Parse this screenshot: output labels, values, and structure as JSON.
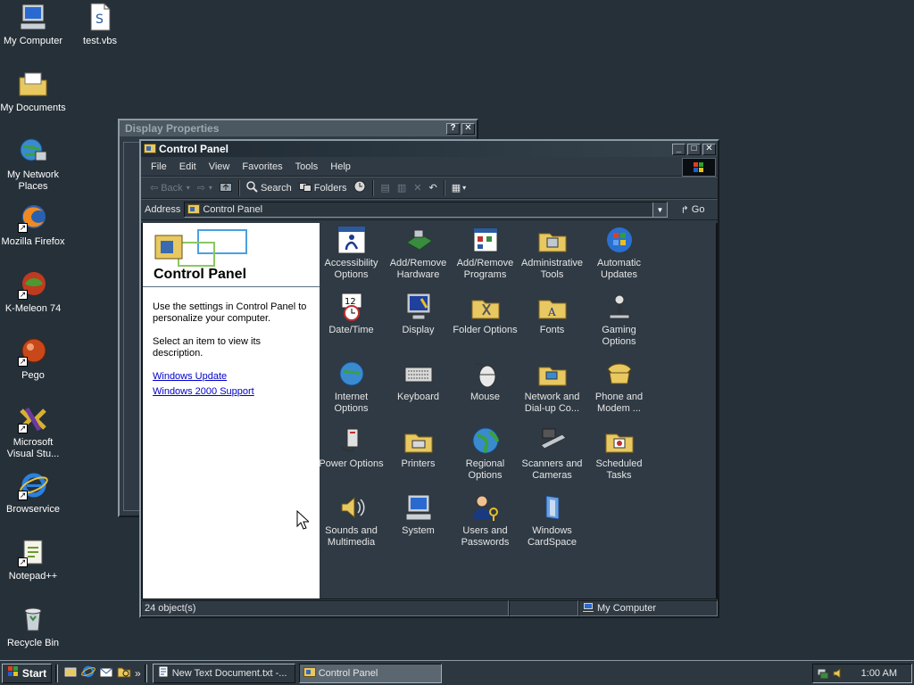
{
  "desktop": {
    "icons": [
      {
        "label": "My Computer"
      },
      {
        "label": "test.vbs"
      },
      {
        "label": "My Documents"
      },
      {
        "label": "My Network Places"
      },
      {
        "label": "Mozilla Firefox"
      },
      {
        "label": "K-Meleon 74"
      },
      {
        "label": "Pego"
      },
      {
        "label": "Microsoft Visual Stu..."
      },
      {
        "label": "Browservice"
      },
      {
        "label": "Notepad++"
      },
      {
        "label": "Recycle Bin"
      }
    ]
  },
  "display_properties": {
    "title": "Display Properties",
    "help_label": "?",
    "close_label": "✕"
  },
  "control_panel": {
    "title": "Control Panel",
    "min_label": "_",
    "max_label": "□",
    "close_label": "✕",
    "menu": [
      "File",
      "Edit",
      "View",
      "Favorites",
      "Tools",
      "Help"
    ],
    "toolbar": {
      "back": "Back",
      "search": "Search",
      "folders": "Folders"
    },
    "address": {
      "label": "Address",
      "value": "Control Panel",
      "go": "Go"
    },
    "left_pane": {
      "title": "Control Panel",
      "text1": "Use the settings in Control Panel to personalize your computer.",
      "text2": "Select an item to view its description.",
      "link1": "Windows Update",
      "link2": "Windows 2000 Support"
    },
    "items": [
      "Accessibility Options",
      "Add/Remove Hardware",
      "Add/Remove Programs",
      "Administrative Tools",
      "Automatic Updates",
      "Date/Time",
      "Display",
      "Folder Options",
      "Fonts",
      "Gaming Options",
      "Internet Options",
      "Keyboard",
      "Mouse",
      "Network and Dial-up Co...",
      "Phone and Modem ...",
      "Power Options",
      "Printers",
      "Regional Options",
      "Scanners and Cameras",
      "Scheduled Tasks",
      "Sounds and Multimedia",
      "System",
      "Users and Passwords",
      "Windows CardSpace"
    ],
    "status": {
      "objects": "24 object(s)",
      "zone": "My Computer"
    }
  },
  "taskbar": {
    "start": "Start",
    "tasks": [
      {
        "label": "New Text Document.txt -..."
      },
      {
        "label": "Control Panel"
      }
    ],
    "clock": "1:00 AM"
  }
}
